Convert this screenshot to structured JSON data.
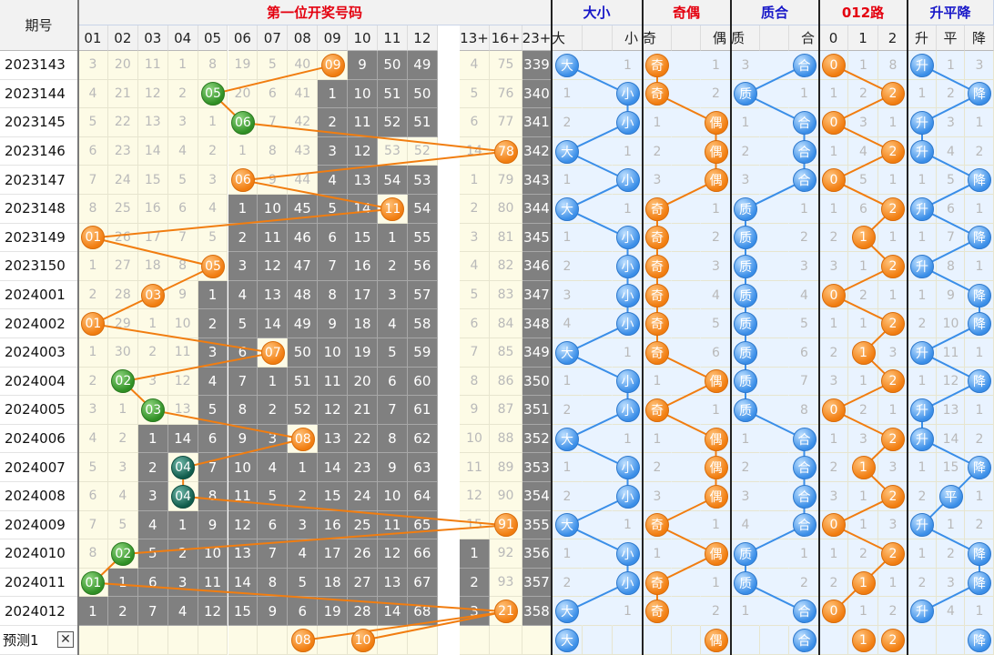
{
  "title": "第一位开奖号码",
  "issue_header": "期号",
  "sections": [
    {
      "label": "大小",
      "color": "#1717c8",
      "cols": [
        "大",
        "小"
      ]
    },
    {
      "label": "奇偶",
      "color": "#e4000f",
      "cols": [
        "奇",
        "偶"
      ]
    },
    {
      "label": "质合",
      "color": "#1717c8",
      "cols": [
        "质",
        "合"
      ]
    },
    {
      "label": "012路",
      "color": "#e4000f",
      "cols": [
        "0",
        "1",
        "2"
      ]
    },
    {
      "label": "升平降",
      "color": "#1717c8",
      "cols": [
        "升",
        "平",
        "降"
      ]
    }
  ],
  "num_cols": [
    "01",
    "02",
    "03",
    "04",
    "05",
    "06",
    "07",
    "08",
    "09",
    "10",
    "11",
    "12",
    "13+",
    "16+",
    "23+"
  ],
  "colors": {
    "orange": "#f17d10",
    "green": "#2f8f24",
    "teal": "#105c4c",
    "blue": "#3a8ee8",
    "grey": "#808080",
    "miss_bg": "#fdfbe6",
    "miss_bg_right": "#e9f3ff"
  },
  "rows": [
    {
      "issue": "2023143",
      "nums": [
        "3",
        "20",
        "11",
        "1",
        "8",
        "19",
        "5",
        "40",
        "09",
        "9",
        "50",
        "49",
        "4",
        "75",
        "339"
      ],
      "ball_col": 8,
      "ball_style": "orange",
      "grey_from": 9,
      "grey_to": 11,
      "big": "大",
      "small": "1",
      "odd": "奇",
      "even": "1",
      "prime": "3",
      "comp": "合",
      "r0": "0",
      "r1": "1",
      "r2": "8",
      "up": "升",
      "flat": "1",
      "down": "3"
    },
    {
      "issue": "2023144",
      "nums": [
        "4",
        "21",
        "12",
        "2",
        "05",
        "20",
        "6",
        "41",
        "1",
        "10",
        "51",
        "50",
        "5",
        "76",
        "340"
      ],
      "ball_col": 4,
      "ball_style": "green",
      "grey_from": 8,
      "grey_to": 11,
      "big": "1",
      "small": "小",
      "odd": "奇",
      "even": "2",
      "prime": "质",
      "comp": "1",
      "r0": "1",
      "r1": "2",
      "r2": "2",
      "up": "1",
      "flat": "2",
      "down": "降"
    },
    {
      "issue": "2023145",
      "nums": [
        "5",
        "22",
        "13",
        "3",
        "1",
        "06",
        "7",
        "42",
        "2",
        "11",
        "52",
        "51",
        "6",
        "77",
        "341"
      ],
      "ball_col": 5,
      "ball_style": "green",
      "grey_from": 8,
      "grey_to": 11,
      "big": "2",
      "small": "小",
      "odd": "1",
      "even": "偶",
      "prime": "1",
      "comp": "合",
      "r0": "0",
      "r1": "3",
      "r2": "1",
      "up": "升",
      "flat": "3",
      "down": "1"
    },
    {
      "issue": "2023146",
      "nums": [
        "6",
        "23",
        "14",
        "4",
        "2",
        "1",
        "8",
        "43",
        "3",
        "12",
        "53",
        "52",
        "14",
        "78",
        "342"
      ],
      "ball_col": 13,
      "ball_style": "orange",
      "grey_from": 8,
      "grey_to": 9,
      "big": "大",
      "small": "1",
      "odd": "2",
      "even": "偶",
      "prime": "2",
      "comp": "合",
      "r0": "1",
      "r1": "4",
      "r2": "2",
      "up": "升",
      "flat": "4",
      "down": "2"
    },
    {
      "issue": "2023147",
      "nums": [
        "7",
        "24",
        "15",
        "5",
        "3",
        "06",
        "9",
        "44",
        "4",
        "13",
        "54",
        "53",
        "1",
        "79",
        "343"
      ],
      "ball_col": 5,
      "ball_style": "orange",
      "grey_from": 8,
      "grey_to": 11,
      "big": "1",
      "small": "小",
      "odd": "3",
      "even": "偶",
      "prime": "3",
      "comp": "合",
      "r0": "0",
      "r1": "5",
      "r2": "1",
      "up": "1",
      "flat": "5",
      "down": "降"
    },
    {
      "issue": "2023148",
      "nums": [
        "8",
        "25",
        "16",
        "6",
        "4",
        "1",
        "10",
        "45",
        "5",
        "14",
        "11",
        "54",
        "2",
        "80",
        "344"
      ],
      "ball_col": 10,
      "ball_style": "orange",
      "grey_from": 5,
      "grey_to": 11,
      "big": "大",
      "small": "1",
      "odd": "奇",
      "even": "1",
      "prime": "质",
      "comp": "1",
      "r0": "1",
      "r1": "6",
      "r2": "2",
      "up": "升",
      "flat": "6",
      "down": "1"
    },
    {
      "issue": "2023149",
      "nums": [
        "01",
        "26",
        "17",
        "7",
        "5",
        "2",
        "11",
        "46",
        "6",
        "15",
        "1",
        "55",
        "3",
        "81",
        "345"
      ],
      "ball_col": 0,
      "ball_style": "orange",
      "grey_from": 5,
      "grey_to": 11,
      "big": "1",
      "small": "小",
      "odd": "奇",
      "even": "2",
      "prime": "质",
      "comp": "2",
      "r0": "2",
      "r1": "1",
      "r2": "1",
      "up": "1",
      "flat": "7",
      "down": "降"
    },
    {
      "issue": "2023150",
      "nums": [
        "1",
        "27",
        "18",
        "8",
        "05",
        "3",
        "12",
        "47",
        "7",
        "16",
        "2",
        "56",
        "4",
        "82",
        "346"
      ],
      "ball_col": 4,
      "ball_style": "orange",
      "grey_from": 5,
      "grey_to": 11,
      "big": "2",
      "small": "小",
      "odd": "奇",
      "even": "3",
      "prime": "质",
      "comp": "3",
      "r0": "3",
      "r1": "1",
      "r2": "2",
      "up": "升",
      "flat": "8",
      "down": "1"
    },
    {
      "issue": "2024001",
      "nums": [
        "2",
        "28",
        "03",
        "9",
        "1",
        "4",
        "13",
        "48",
        "8",
        "17",
        "3",
        "57",
        "5",
        "83",
        "347"
      ],
      "ball_col": 2,
      "ball_style": "orange",
      "grey_from": 4,
      "grey_to": 11,
      "big": "3",
      "small": "小",
      "odd": "奇",
      "even": "4",
      "prime": "质",
      "comp": "4",
      "r0": "0",
      "r1": "2",
      "r2": "1",
      "up": "1",
      "flat": "9",
      "down": "降"
    },
    {
      "issue": "2024002",
      "nums": [
        "01",
        "29",
        "1",
        "10",
        "2",
        "5",
        "14",
        "49",
        "9",
        "18",
        "4",
        "58",
        "6",
        "84",
        "348"
      ],
      "ball_col": 0,
      "ball_style": "orange",
      "grey_from": 4,
      "grey_to": 11,
      "big": "4",
      "small": "小",
      "odd": "奇",
      "even": "5",
      "prime": "质",
      "comp": "5",
      "r0": "1",
      "r1": "1",
      "r2": "2",
      "up": "2",
      "flat": "10",
      "down": "降"
    },
    {
      "issue": "2024003",
      "nums": [
        "1",
        "30",
        "2",
        "11",
        "3",
        "6",
        "07",
        "50",
        "10",
        "19",
        "5",
        "59",
        "7",
        "85",
        "349"
      ],
      "ball_col": 6,
      "ball_style": "orange",
      "grey_from": 4,
      "grey_to": 11,
      "big": "大",
      "small": "1",
      "odd": "奇",
      "even": "6",
      "prime": "质",
      "comp": "6",
      "r0": "2",
      "r1": "1",
      "r2": "3",
      "up": "升",
      "flat": "11",
      "down": "1"
    },
    {
      "issue": "2024004",
      "nums": [
        "2",
        "02",
        "3",
        "12",
        "4",
        "7",
        "1",
        "51",
        "11",
        "20",
        "6",
        "60",
        "8",
        "86",
        "350"
      ],
      "ball_col": 1,
      "ball_style": "green",
      "grey_from": 4,
      "grey_to": 11,
      "big": "1",
      "small": "小",
      "odd": "1",
      "even": "偶",
      "prime": "质",
      "comp": "7",
      "r0": "3",
      "r1": "1",
      "r2": "2",
      "up": "1",
      "flat": "12",
      "down": "降"
    },
    {
      "issue": "2024005",
      "nums": [
        "3",
        "1",
        "03",
        "13",
        "5",
        "8",
        "2",
        "52",
        "12",
        "21",
        "7",
        "61",
        "9",
        "87",
        "351"
      ],
      "ball_col": 2,
      "ball_style": "green",
      "grey_from": 4,
      "grey_to": 11,
      "big": "2",
      "small": "小",
      "odd": "奇",
      "even": "1",
      "prime": "质",
      "comp": "8",
      "r0": "0",
      "r1": "2",
      "r2": "1",
      "up": "升",
      "flat": "13",
      "down": "1"
    },
    {
      "issue": "2024006",
      "nums": [
        "4",
        "2",
        "1",
        "14",
        "6",
        "9",
        "3",
        "08",
        "13",
        "22",
        "8",
        "62",
        "10",
        "88",
        "352"
      ],
      "ball_col": 7,
      "ball_style": "orange",
      "grey_from": 2,
      "grey_to": 11,
      "big": "大",
      "small": "1",
      "odd": "1",
      "even": "偶",
      "prime": "1",
      "comp": "合",
      "r0": "1",
      "r1": "3",
      "r2": "2",
      "up": "升",
      "flat": "14",
      "down": "2"
    },
    {
      "issue": "2024007",
      "nums": [
        "5",
        "3",
        "2",
        "04",
        "7",
        "10",
        "4",
        "1",
        "14",
        "23",
        "9",
        "63",
        "11",
        "89",
        "353"
      ],
      "ball_col": 3,
      "ball_style": "teal",
      "grey_from": 2,
      "grey_to": 11,
      "big": "1",
      "small": "小",
      "odd": "2",
      "even": "偶",
      "prime": "2",
      "comp": "合",
      "r0": "2",
      "r1": "1",
      "r2": "3",
      "up": "1",
      "flat": "15",
      "down": "降"
    },
    {
      "issue": "2024008",
      "nums": [
        "6",
        "4",
        "3",
        "04",
        "8",
        "11",
        "5",
        "2",
        "15",
        "24",
        "10",
        "64",
        "12",
        "90",
        "354"
      ],
      "ball_col": 3,
      "ball_style": "teal",
      "grey_from": 2,
      "grey_to": 11,
      "big": "2",
      "small": "小",
      "odd": "3",
      "even": "偶",
      "prime": "3",
      "comp": "合",
      "r0": "3",
      "r1": "1",
      "r2": "2",
      "up": "2",
      "flat": "平",
      "down": "1"
    },
    {
      "issue": "2024009",
      "nums": [
        "7",
        "5",
        "4",
        "1",
        "9",
        "12",
        "6",
        "3",
        "16",
        "25",
        "11",
        "65",
        "15",
        "91",
        "355"
      ],
      "ball_col": 13,
      "ball_style": "orange",
      "grey_from": 2,
      "grey_to": 11,
      "big": "大",
      "small": "1",
      "odd": "奇",
      "even": "1",
      "prime": "4",
      "comp": "合",
      "r0": "0",
      "r1": "1",
      "r2": "3",
      "up": "升",
      "flat": "1",
      "down": "2"
    },
    {
      "issue": "2024010",
      "nums": [
        "8",
        "02",
        "5",
        "2",
        "10",
        "13",
        "7",
        "4",
        "17",
        "26",
        "12",
        "66",
        "1",
        "92",
        "356"
      ],
      "ball_col": 1,
      "ball_style": "green",
      "grey_from": 2,
      "grey_to": 12,
      "big": "1",
      "small": "小",
      "odd": "1",
      "even": "偶",
      "prime": "质",
      "comp": "1",
      "r0": "1",
      "r1": "2",
      "r2": "2",
      "up": "1",
      "flat": "2",
      "down": "降"
    },
    {
      "issue": "2024011",
      "nums": [
        "01",
        "1",
        "6",
        "3",
        "11",
        "14",
        "8",
        "5",
        "18",
        "27",
        "13",
        "67",
        "2",
        "93",
        "357"
      ],
      "ball_col": 0,
      "ball_style": "green",
      "grey_from": 1,
      "grey_to": 12,
      "big": "2",
      "small": "小",
      "odd": "奇",
      "even": "1",
      "prime": "质",
      "comp": "2",
      "r0": "2",
      "r1": "1",
      "r2": "1",
      "up": "2",
      "flat": "3",
      "down": "降"
    },
    {
      "issue": "2024012",
      "nums": [
        "1",
        "2",
        "7",
        "4",
        "12",
        "15",
        "9",
        "6",
        "19",
        "28",
        "14",
        "68",
        "3",
        "21",
        "358"
      ],
      "ball_col": 13,
      "ball_style": "orange",
      "grey_from": 0,
      "grey_to": 12,
      "big": "大",
      "small": "1",
      "odd": "奇",
      "even": "2",
      "prime": "1",
      "comp": "合",
      "r0": "0",
      "r1": "1",
      "r2": "2",
      "up": "升",
      "flat": "4",
      "down": "1"
    }
  ],
  "forecast": {
    "label": "预测1",
    "close": "✕",
    "balls": [
      "08",
      "10"
    ],
    "big": "大",
    "even": "偶",
    "comp": "合",
    "r1": "1",
    "r2": "2",
    "down": "降"
  }
}
